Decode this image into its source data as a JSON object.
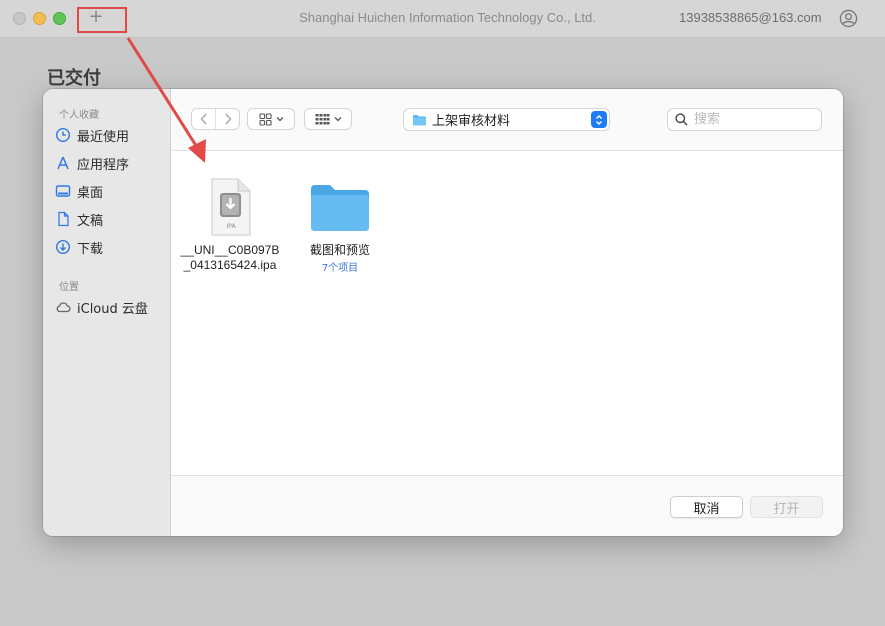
{
  "window": {
    "title": "Shanghai Huichen Information Technology Co., Ltd.",
    "account": "13938538865@163.com",
    "add_button": "+",
    "page_heading": "已交付"
  },
  "sidebar": {
    "favorites_label": "个人收藏",
    "locations_label": "位置",
    "items": [
      {
        "label": "最近使用",
        "icon": "clock-icon"
      },
      {
        "label": "应用程序",
        "icon": "applications-icon"
      },
      {
        "label": "桌面",
        "icon": "desktop-icon"
      },
      {
        "label": "文稿",
        "icon": "document-icon"
      },
      {
        "label": "下载",
        "icon": "download-icon"
      }
    ],
    "locations": [
      {
        "label": "iCloud 云盘",
        "icon": "cloud-icon"
      }
    ]
  },
  "toolbar": {
    "back": "‹",
    "forward": "›",
    "path_folder": "上架审核材料",
    "search_placeholder": "搜索"
  },
  "files": [
    {
      "name_line1": "__UNI__C0B097B",
      "name_line2": "_0413165424.ipa",
      "icon_label": "IPA"
    },
    {
      "name_line1": "截图和预览",
      "sub": "7个项目"
    }
  ],
  "footer": {
    "cancel": "取消",
    "open": "打开"
  },
  "colors": {
    "accent": "#1f7cf4",
    "annotation": "#e24a4a",
    "folder": "#5cb8ef"
  }
}
